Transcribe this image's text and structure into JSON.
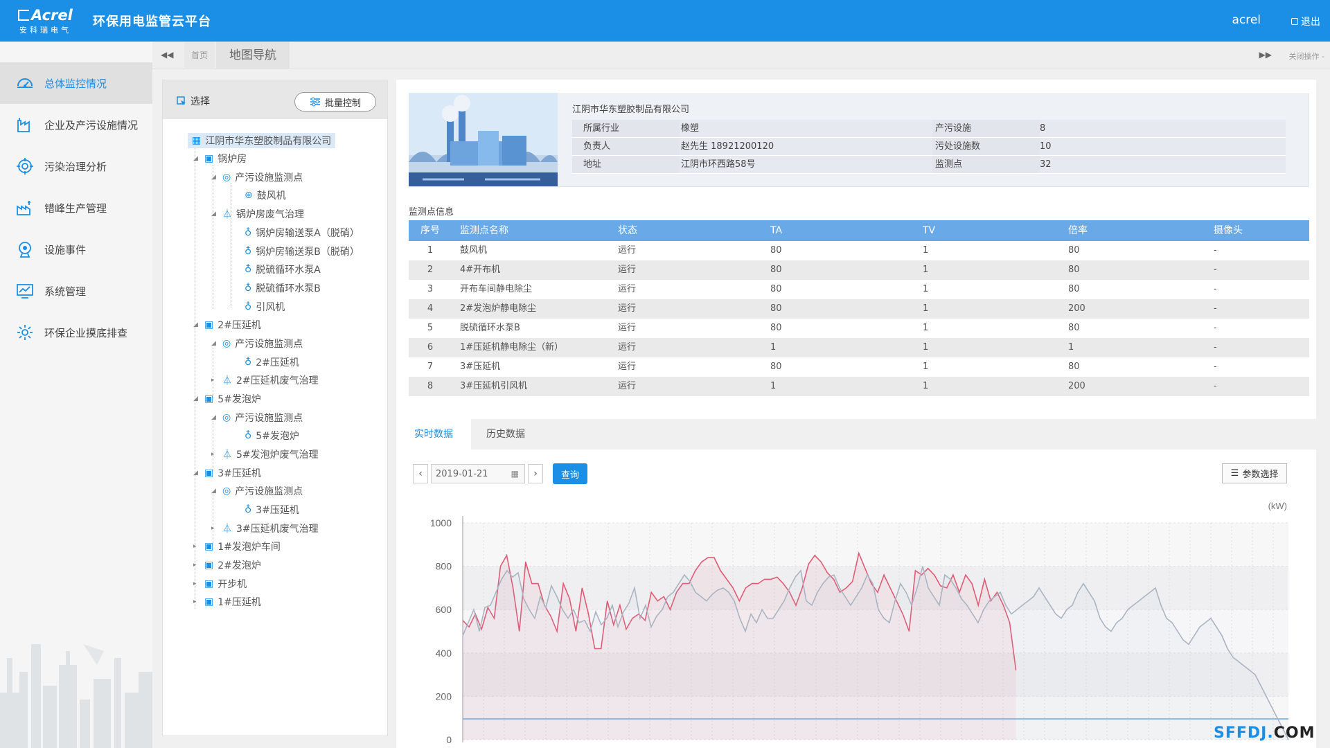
{
  "header": {
    "logo_text": "Acrel",
    "logo_sub": "安科瑞电气",
    "title": "环保用电监管云平台",
    "user": "acrel",
    "logout": "退出"
  },
  "sidebar": {
    "items": [
      {
        "label": "总体监控情况",
        "icon": "dashboard-icon",
        "active": true
      },
      {
        "label": "企业及产污设施情况",
        "icon": "factory-icon"
      },
      {
        "label": "污染治理分析",
        "icon": "target-icon"
      },
      {
        "label": "错峰生产管理",
        "icon": "production-icon"
      },
      {
        "label": "设施事件",
        "icon": "event-icon"
      },
      {
        "label": "系统管理",
        "icon": "monitor-chart-icon"
      },
      {
        "label": "环保企业摸底排查",
        "icon": "gear-icon"
      }
    ]
  },
  "tabbar": {
    "home": "首页",
    "map": "地图导航",
    "close_ops": "关闭操作 -"
  },
  "tree_panel": {
    "select_label": "选择",
    "batch_label": "批量控制",
    "nodes": [
      {
        "label": "江阴市华东塑胶制品有限公司"
      },
      {
        "label": "锅炉房"
      },
      {
        "label": "产污设施监测点"
      },
      {
        "label": "鼓风机"
      },
      {
        "label": "锅炉房废气治理"
      },
      {
        "label": "锅炉房输送泵A（脱硝）"
      },
      {
        "label": "锅炉房输送泵B（脱硝）"
      },
      {
        "label": "脱硫循环水泵A"
      },
      {
        "label": "脱硫循环水泵B"
      },
      {
        "label": "引风机"
      },
      {
        "label": "2#压延机"
      },
      {
        "label": "产污设施监测点"
      },
      {
        "label": "2#压延机"
      },
      {
        "label": "2#压延机废气治理"
      },
      {
        "label": "5#发泡炉"
      },
      {
        "label": "产污设施监测点"
      },
      {
        "label": "5#发泡炉"
      },
      {
        "label": "5#发泡炉废气治理"
      },
      {
        "label": "3#压延机"
      },
      {
        "label": "产污设施监测点"
      },
      {
        "label": "3#压延机"
      },
      {
        "label": "3#压延机废气治理"
      },
      {
        "label": "1#发泡炉车间"
      },
      {
        "label": "2#发泡炉"
      },
      {
        "label": "开步机"
      },
      {
        "label": "1#压延机"
      }
    ]
  },
  "company": {
    "name": "江阴市华东塑胶制品有限公司",
    "rows": [
      [
        "所属行业",
        "橡塑",
        "产污设施",
        "8"
      ],
      [
        "负责人",
        "赵先生  18921200120",
        "污处设施数",
        "10"
      ],
      [
        "地址",
        "江阴市环西路58号",
        "监测点",
        "32"
      ]
    ]
  },
  "monitor": {
    "title": "监测点信息",
    "headers": [
      "序号",
      "监测点名称",
      "状态",
      "TA",
      "TV",
      "倍率",
      "摄像头"
    ],
    "rows": [
      [
        "1",
        "鼓风机",
        "运行",
        "80",
        "1",
        "80",
        "-"
      ],
      [
        "2",
        "4#开布机",
        "运行",
        "80",
        "1",
        "80",
        "-"
      ],
      [
        "3",
        "开布车间静电除尘",
        "运行",
        "80",
        "1",
        "80",
        "-"
      ],
      [
        "4",
        "2#发泡炉静电除尘",
        "运行",
        "80",
        "1",
        "200",
        "-"
      ],
      [
        "5",
        "脱硫循环水泵B",
        "运行",
        "80",
        "1",
        "80",
        "-"
      ],
      [
        "6",
        "1#压延机静电除尘（新）",
        "运行",
        "1",
        "1",
        "1",
        "-"
      ],
      [
        "7",
        "3#压延机",
        "运行",
        "80",
        "1",
        "80",
        "-"
      ],
      [
        "8",
        "3#压延机引风机",
        "运行",
        "1",
        "1",
        "200",
        "-"
      ]
    ]
  },
  "lower": {
    "tab_realtime": "实时数据",
    "tab_history": "历史数据",
    "date": "2019-01-21",
    "query": "查询",
    "param": "参数选择"
  },
  "chart_data": {
    "type": "line",
    "unit": "(kW)",
    "ylim": [
      0,
      1000
    ],
    "yticks": [
      "1000",
      "800",
      "600",
      "400",
      "200",
      "0"
    ],
    "colors": {
      "red": "#e05a75",
      "gray": "#aab4c2",
      "base": "#6fa8dc"
    },
    "series": [
      {
        "color": "red",
        "values": [
          550,
          520,
          580,
          510,
          610,
          560,
          800,
          850,
          700,
          500,
          820,
          720,
          720,
          620,
          570,
          500,
          720,
          650,
          500,
          700,
          580,
          420,
          420,
          640,
          530,
          620,
          510,
          560,
          580,
          550,
          680,
          640,
          660,
          600,
          680,
          720,
          720,
          780,
          820,
          840,
          840,
          780,
          740,
          700,
          640,
          700,
          720,
          720,
          740,
          740,
          750,
          720,
          680,
          620,
          700,
          810,
          850,
          820,
          770,
          740,
          680,
          700,
          730,
          860,
          790,
          720,
          680,
          760,
          700,
          640,
          580,
          500,
          780,
          760,
          790,
          760,
          710,
          700,
          760,
          680,
          760,
          720,
          620,
          740,
          640,
          680,
          620,
          540,
          320
        ]
      },
      {
        "color": "gray",
        "values": [
          480,
          540,
          600,
          500,
          610,
          620,
          680,
          740,
          780,
          750,
          770,
          650,
          600,
          560,
          660,
          610,
          710,
          660,
          600,
          560,
          600,
          540,
          550,
          500,
          590,
          530,
          560,
          620,
          520,
          590,
          630,
          700,
          560,
          620,
          520,
          570,
          600,
          660,
          680,
          720,
          760,
          730,
          680,
          660,
          640,
          670,
          690,
          700,
          680,
          640,
          560,
          500,
          580,
          540,
          600,
          560,
          560,
          600,
          640,
          700,
          750,
          780,
          640,
          620,
          680,
          720,
          750,
          760,
          700,
          660,
          620,
          660,
          700,
          760,
          720,
          600,
          560,
          540,
          640,
          720,
          680,
          620,
          700,
          800,
          700,
          660,
          620,
          760,
          740,
          700,
          650,
          620,
          580,
          540,
          600,
          640,
          660,
          680,
          620,
          580,
          600,
          620,
          640,
          660,
          700,
          660,
          620,
          580,
          560,
          600,
          620,
          680,
          720,
          680,
          640,
          560,
          520,
          500,
          540,
          560,
          600,
          620,
          640,
          660,
          680,
          700,
          620,
          560,
          540,
          500,
          460,
          440,
          480,
          520,
          540,
          560,
          520,
          480,
          420,
          380,
          360,
          340,
          320,
          300,
          250,
          200,
          150,
          100,
          50,
          0
        ]
      }
    ]
  }
}
